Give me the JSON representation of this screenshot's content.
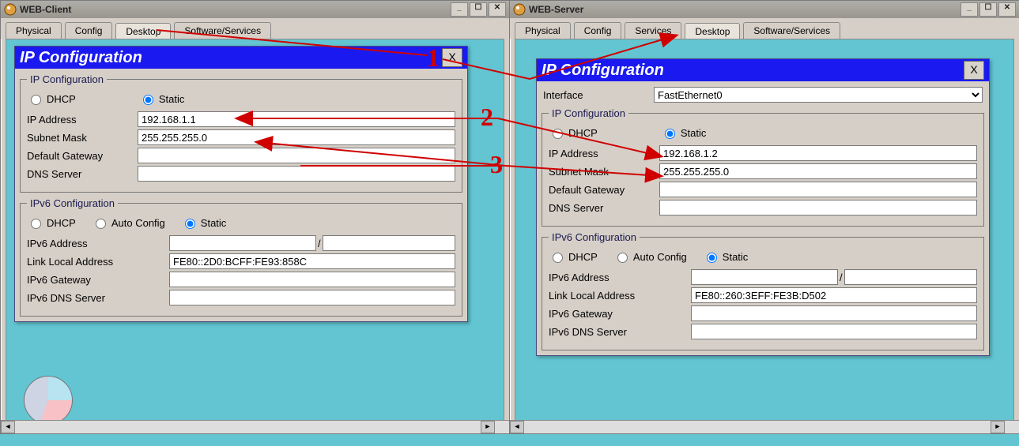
{
  "annotations": {
    "n1": "1",
    "n2": "2",
    "n3": "3"
  },
  "left": {
    "title": "WEB-Client",
    "tabs": {
      "physical": "Physical",
      "config": "Config",
      "desktop": "Desktop",
      "software": "Software/Services"
    },
    "dlg_title": "IP Configuration",
    "close": "X",
    "ipconf": {
      "legend": "IP Configuration",
      "dhcp": "DHCP",
      "static": "Static",
      "ip_label": "IP Address",
      "ip": "192.168.1.1",
      "mask_label": "Subnet Mask",
      "mask": "255.255.255.0",
      "gw_label": "Default Gateway",
      "gw": "",
      "dns_label": "DNS Server",
      "dns": ""
    },
    "ipv6": {
      "legend": "IPv6 Configuration",
      "dhcp": "DHCP",
      "auto": "Auto Config",
      "static": "Static",
      "addr_label": "IPv6 Address",
      "addr": "",
      "lla_label": "Link Local Address",
      "lla": "FE80::2D0:BCFF:FE93:858C",
      "gw_label": "IPv6 Gateway",
      "gw": "",
      "dns_label": "IPv6 DNS Server",
      "dns": ""
    }
  },
  "right": {
    "title": "WEB-Server",
    "tabs": {
      "physical": "Physical",
      "config": "Config",
      "services": "Services",
      "desktop": "Desktop",
      "software": "Software/Services"
    },
    "dlg_title": "IP Configuration",
    "close": "X",
    "iface_label": "Interface",
    "iface": "FastEthernet0",
    "ipconf": {
      "legend": "IP Configuration",
      "dhcp": "DHCP",
      "static": "Static",
      "ip_label": "IP Address",
      "ip": "192.168.1.2",
      "mask_label": "Subnet Mask",
      "mask": "255.255.255.0",
      "gw_label": "Default Gateway",
      "gw": "",
      "dns_label": "DNS Server",
      "dns": ""
    },
    "ipv6": {
      "legend": "IPv6 Configuration",
      "dhcp": "DHCP",
      "auto": "Auto Config",
      "static": "Static",
      "addr_label": "IPv6 Address",
      "addr": "",
      "lla_label": "Link Local Address",
      "lla": "FE80::260:3EFF:FE3B:D502",
      "gw_label": "IPv6 Gateway",
      "gw": "",
      "dns_label": "IPv6 DNS Server",
      "dns": ""
    }
  }
}
